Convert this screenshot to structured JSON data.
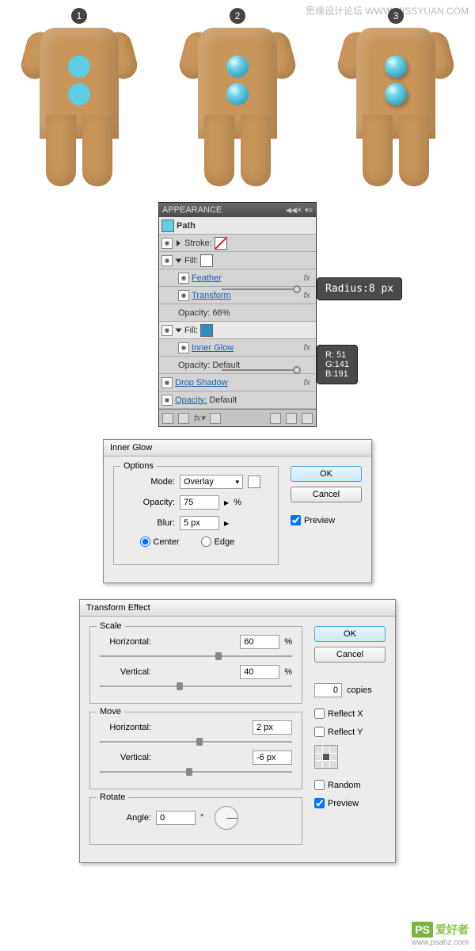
{
  "watermarks": {
    "top": "思缘设计论坛 WWW.MISSYUAN.COM",
    "logo": "PS",
    "logotext": "爱好者",
    "url": "www.psahz.com"
  },
  "steps": [
    "1",
    "2",
    "3"
  ],
  "appearance": {
    "title": "APPEARANCE",
    "path": "Path",
    "stroke": "Stroke:",
    "fill": "Fill:",
    "feather": "Feather",
    "transform": "Transform",
    "opacity1": "Opacity:",
    "opacity1_val": "66%",
    "inner_glow": "Inner Glow",
    "opacity2": "Opacity:",
    "opacity2_val": "Default",
    "drop_shadow": "Drop Shadow",
    "opacity3": "Opacity:",
    "opacity3_val": "Default",
    "fx": "fx"
  },
  "callouts": {
    "radius": "Radius:8 px",
    "rgb": {
      "r": "R:  51",
      "g": "G:141",
      "b": "B:191"
    }
  },
  "inner_glow_dlg": {
    "title": "Inner Glow",
    "options": "Options",
    "mode": "Mode:",
    "mode_val": "Overlay",
    "opacity": "Opacity:",
    "opacity_val": "75",
    "pct": "%",
    "blur": "Blur:",
    "blur_val": "5 px",
    "center": "Center",
    "edge": "Edge",
    "ok": "OK",
    "cancel": "Cancel",
    "preview": "Preview"
  },
  "transform_dlg": {
    "title": "Transform Effect",
    "scale": "Scale",
    "move": "Move",
    "rotate": "Rotate",
    "horizontal": "Horizontal:",
    "vertical": "Vertical:",
    "scale_h": "60",
    "scale_v": "40",
    "pct": "%",
    "move_h": "2 px",
    "move_v": "-6 px",
    "angle": "Angle:",
    "angle_val": "0",
    "deg": "°",
    "copies_val": "0",
    "copies": "copies",
    "reflect_x": "Reflect X",
    "reflect_y": "Reflect Y",
    "random": "Random",
    "preview": "Preview",
    "ok": "OK",
    "cancel": "Cancel"
  },
  "chart_data": null
}
